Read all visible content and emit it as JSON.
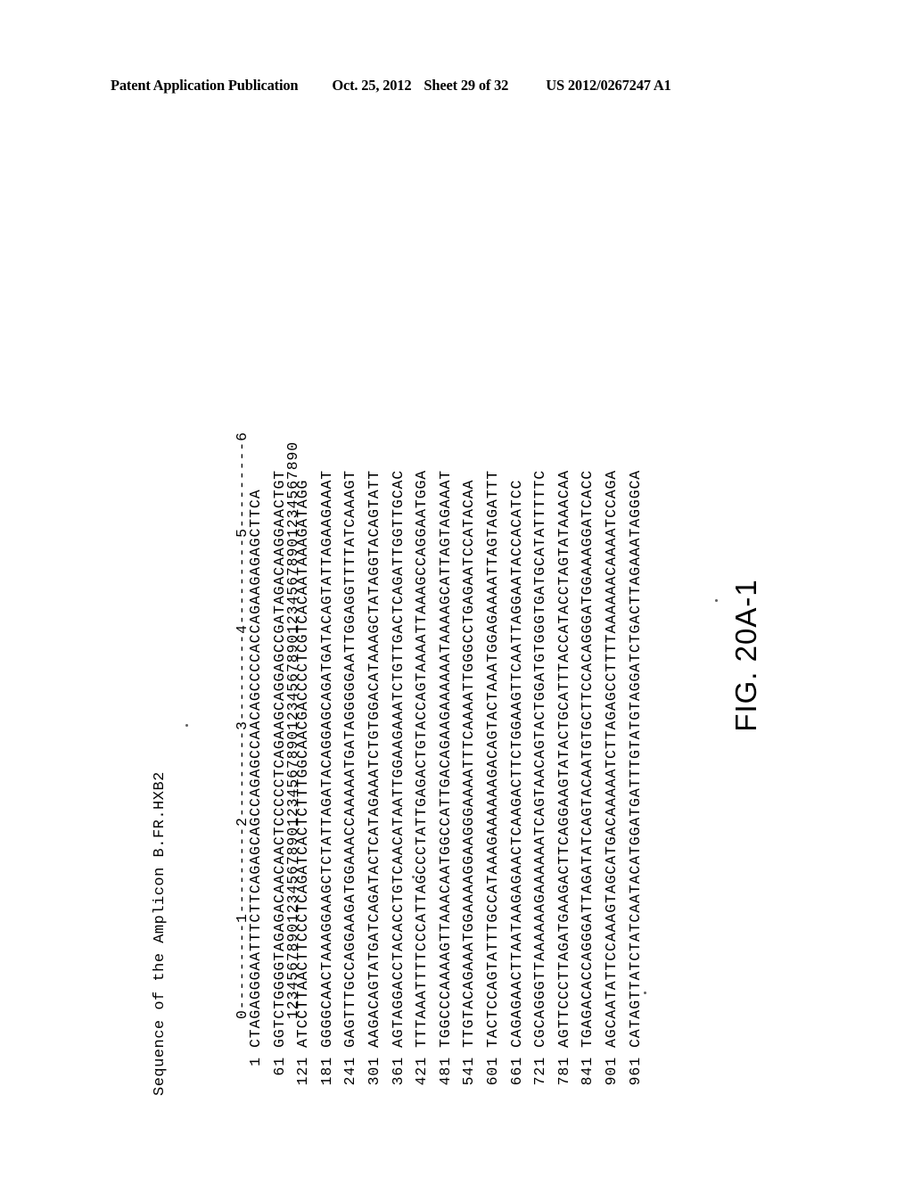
{
  "header": {
    "publication": "Patent Application Publication",
    "date": "Oct. 25, 2012",
    "sheet": "Sheet 29 of 32",
    "patent_number": "US 2012/0267247 A1"
  },
  "figure": {
    "title": "Sequence of the Amplicon B.FR.HXB2",
    "caption": "FIG. 20A-1",
    "ruler": {
      "tens_line": "0---------1---------2---------3---------4---------5---------6",
      "ones_line": "123456789012345678901234567890123456789012345678901234567890"
    },
    "columns": [
      "position",
      "sequence"
    ],
    "rows": [
      {
        "position": "1",
        "sequence": "CTAGAGGGAATTTCTTCAGAGCAGCCAGAGCCAACAGCCCCACCAGAAGAGAGCTTCA"
      },
      {
        "position": "61",
        "sequence": "GGTCTGGGGTAGAGACAACAACTCCCCCTCAGAAGCAGGAGCCGATAGACAAGGAACTGT"
      },
      {
        "position": "121",
        "sequence": "ATCCTTAACTTCCCTCAGATCACTCTTTGGCAACGACCCCTCGTCACAATAAAGATAGG"
      },
      {
        "position": "181",
        "sequence": "GGGGCAACTAAAGGAAGCTCTATTAGATACAGGAGCAGATGATACAGTATTAGAAGAAAT"
      },
      {
        "position": "241",
        "sequence": "GAGTTTGCCAGGAAGATGGAAACCAAAAATGATAGGGGGAATTGGAGGTTTTATCAAAGT"
      },
      {
        "position": "301",
        "sequence": "AAGACAGTATGATCAGATACTCATAGAAATCTGTGGACATAAAGCTATAGGTACAGTATT"
      },
      {
        "position": "361",
        "sequence": "AGTAGGACCTACACCTGTCAACATAATTGGAAGAAATCTGTTGACTCAGATTGGTTGCAC"
      },
      {
        "position": "421",
        "sequence": "TTTAAATTTTCCCATTAGCCCTATTGAGACTGTACCAGTAAAATTAAAGCCAGGAATGGA"
      },
      {
        "position": "481",
        "sequence": "TGGCCCAAAAGTTAAACAATGGCCATTGACAGAAGAAAAAATAAAAGCATTAGTAGAAAT"
      },
      {
        "position": "541",
        "sequence": "TTGTACAGAAATGGAAAAGGAAGGGAAAATTTCAAAATTGGGCCTGAGAATCCATACAA"
      },
      {
        "position": "601",
        "sequence": "TACTCCAGTATTTGCCATAAAGAAAAAAGACAGTACTAAATGGAGAAAATTAGTAGATTT"
      },
      {
        "position": "661",
        "sequence": "CAGAGAACTTAATAAGAGAACTCAAGACTTCTGGAAGTTCAATTAGGAATACCACATCC"
      },
      {
        "position": "721",
        "sequence": "CGCAGGGTTAAAAAAGAAAAAATCAGTAACAGTACTGGATGTGGGTGATGCATATTTTTC"
      },
      {
        "position": "781",
        "sequence": "AGTTCCCTTAGATGAAGACTTCAGGAAGTATACTGCATTTACCATACCTAGTATAAACAA"
      },
      {
        "position": "841",
        "sequence": "TGAGACACCAGGGATTAGATATCAGTACAATGTGCTTCCACAGGGATGGAAAGGATCACC"
      },
      {
        "position": "901",
        "sequence": "AGCAATATTCCAAAGTAGCATGACAAAAATCTTAGAGCCTTTTAAAAAACAAAATCCAGA"
      },
      {
        "position": "961",
        "sequence": "CATAGTTATCTATCAATACATGGATGATTTGTATGTAGGATCTGACTTAGAAATAGGGCA"
      }
    ]
  }
}
